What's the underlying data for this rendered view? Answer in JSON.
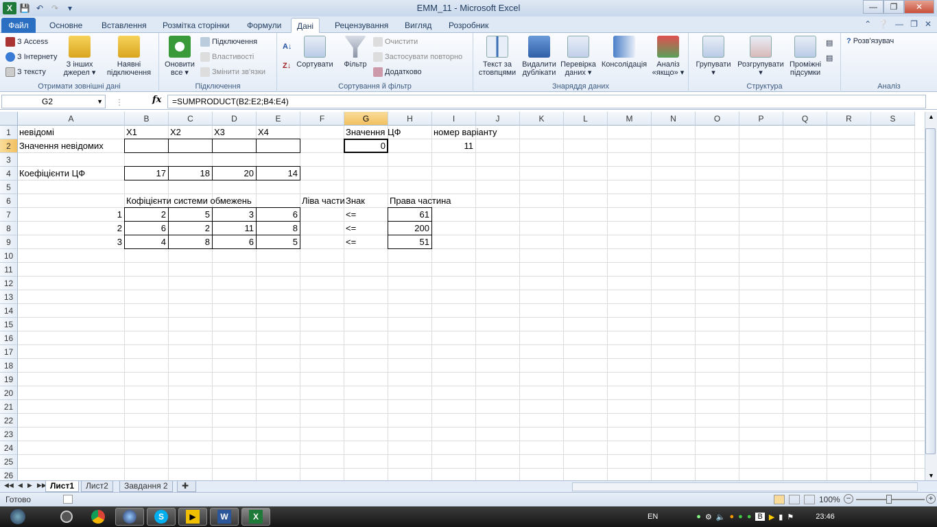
{
  "window": {
    "title": "EMM_11  -  Microsoft Excel"
  },
  "ribbon_tabs": [
    "Файл",
    "Основне",
    "Вставлення",
    "Розмітка сторінки",
    "Формули",
    "Дані",
    "Рецензування",
    "Вигляд",
    "Розробник"
  ],
  "active_tab": "Дані",
  "groups": {
    "external": {
      "label": "Отримати зовнішні дані",
      "access": "З Access",
      "web": "З Інтернету",
      "text": "З тексту",
      "other_line1": "З інших",
      "other_line2": "джерел",
      "existing_line1": "Наявні",
      "existing_line2": "підключення"
    },
    "connections": {
      "label": "Підключення",
      "refresh_line1": "Оновити",
      "refresh_line2": "все",
      "connections": "Підключення",
      "properties": "Властивості",
      "edit_links": "Змінити зв'язки"
    },
    "sort": {
      "label": "Сортування й фільтр",
      "sort": "Сортувати",
      "filter": "Фільтр",
      "clear": "Очистити",
      "reapply": "Застосувати повторно",
      "advanced": "Додатково"
    },
    "tools": {
      "label": "Знаряддя даних",
      "text_to_cols_1": "Текст за",
      "text_to_cols_2": "стовпцями",
      "remove_dup_1": "Видалити",
      "remove_dup_2": "дублікати",
      "validation_1": "Перевірка",
      "validation_2": "даних",
      "consolidate": "Консолідація",
      "whatif_1": "Аналіз",
      "whatif_2": "«якщо»"
    },
    "outline": {
      "label": "Структура",
      "group": "Групувати",
      "ungroup": "Розгрупувати",
      "subtotal_1": "Проміжні",
      "subtotal_2": "підсумки"
    },
    "analysis": {
      "label": "Аналіз",
      "solver": "Розв'язувач"
    }
  },
  "formula_bar": {
    "name_box": "G2",
    "fx": "fx",
    "formula": "=SUMPRODUCT(B2:E2;B4:E4)"
  },
  "columns": [
    "A",
    "B",
    "C",
    "D",
    "E",
    "F",
    "G",
    "H",
    "I",
    "J",
    "K",
    "L",
    "M",
    "N",
    "O",
    "P",
    "Q",
    "R",
    "S"
  ],
  "rows": [
    "1",
    "2",
    "3",
    "4",
    "5",
    "6",
    "7",
    "8",
    "9",
    "10",
    "11",
    "12",
    "13",
    "14",
    "15",
    "16",
    "17",
    "18",
    "19",
    "20",
    "21",
    "22",
    "23",
    "24",
    "25",
    "26"
  ],
  "cells": {
    "A1": "невідомі",
    "B1": "X1",
    "C1": "X2",
    "D1": "X3",
    "E1": "X4",
    "G1": "Значення ЦФ",
    "I1": "номер варіанту",
    "A2": "Значення невідомих",
    "G2": "0",
    "I2": "11",
    "A4": "Коефіцієнти ЦФ",
    "B4": "17",
    "C4": "18",
    "D4": "20",
    "E4": "14",
    "B6": "Кофіцієнти системи обмежень",
    "F6": "Ліва частина",
    "G6": "Знак",
    "H6": "Права частина",
    "A7": "1",
    "B7": "2",
    "C7": "5",
    "D7": "3",
    "E7": "6",
    "G7": "<=",
    "H7": "61",
    "A8": "2",
    "B8": "6",
    "C8": "2",
    "D8": "11",
    "E8": "8",
    "G8": "<=",
    "H8": "200",
    "A9": "3",
    "B9": "4",
    "C9": "8",
    "D9": "6",
    "E9": "5",
    "G9": "<=",
    "H9": "51"
  },
  "sheets": [
    "Лист1",
    "Лист2",
    "Завдання 2"
  ],
  "active_sheet": "Лист1",
  "status": {
    "ready": "Готово",
    "zoom": "100%"
  },
  "taskbar": {
    "lang": "EN",
    "time": "23:46"
  }
}
